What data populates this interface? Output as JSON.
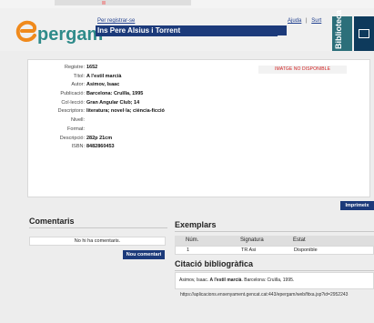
{
  "colors": {
    "navy": "#1c3a7a",
    "teal": "#2f8b8a",
    "red": "#d02020",
    "bg": "#ededed"
  },
  "header": {
    "logo_text": "pergam",
    "register_link": "Per registrar-se",
    "school_name": "Ins Pere Alsius i Torrent",
    "help_link": "Ajuda",
    "logout_link": "Surt",
    "separator": "|",
    "brand_vertical": "Biblioteca"
  },
  "record": {
    "fields": [
      {
        "label": "Registre:",
        "value": "1652"
      },
      {
        "label": "Títol:",
        "value": "A l'estil marcià"
      },
      {
        "label": "Autor:",
        "value": "Asimov, Isaac"
      },
      {
        "label": "Publicació:",
        "value": "Barcelona: Cruïlla, 1995"
      },
      {
        "label": "Col·lecció:",
        "value": "Gran Angular Club; 14"
      },
      {
        "label": "Descriptors:",
        "value": "literatura; novel·la; ciència-ficció"
      },
      {
        "label": "Nivell:",
        "value": ""
      },
      {
        "label": "Format:",
        "value": ""
      },
      {
        "label": "Descripció:",
        "value": "282p 21cm"
      },
      {
        "label": "ISBN:",
        "value": "8482860453"
      }
    ],
    "no_image": "IMATGE NO DISPONIBLE"
  },
  "print_button": "Imprimeix",
  "comments": {
    "heading": "Comentaris",
    "empty_text": "No hi ha comentaris.",
    "new_button": "Nou comentari"
  },
  "copies": {
    "heading": "Exemplars",
    "columns": [
      "Núm.",
      "Signatura",
      "Estat"
    ],
    "rows": [
      {
        "num": "1",
        "signature": "TR Asi",
        "status": "Disponible"
      }
    ]
  },
  "citation": {
    "heading": "Citació bibliogràfica",
    "author": "Asimov, Isaac.",
    "title": "A l'estil marcià",
    "rest": ". Barcelona: Cruïlla, 1995.",
    "url": "https://aplicacions.ensenyament.gencat.cat:443/epergam/web/fitxa.jsp?id=2952243"
  }
}
